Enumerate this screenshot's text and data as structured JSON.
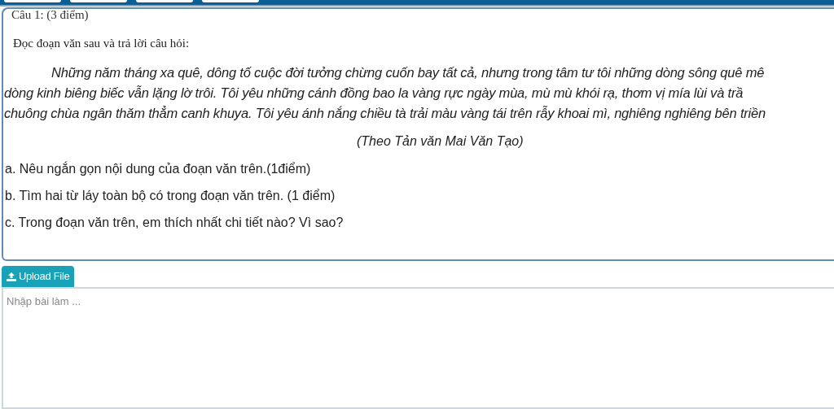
{
  "top_tabs": [
    {
      "kind": "tab"
    },
    {
      "kind": "tab"
    },
    {
      "kind": "tab"
    },
    {
      "kind": "tab"
    }
  ],
  "question": {
    "title": "Câu 1: (3 điểm)",
    "instruction": "Đọc đoạn văn sau và trả lời câu hỏi:",
    "passage_lines": [
      "Những năm tháng xa quê, dông tố cuộc đời tưởng chừng cuốn bay tất cả, nhưng trong tâm tư tôi những dòng sông quê mê",
      "dòng kinh biêng biếc vẫn lặng lờ trôi. Tôi yêu những cánh đồng bao la vàng rực ngày mùa, mù mù khói rạ, thơm vị mía lùi và trầ",
      "chuông chùa ngân thăm thẳm canh khuya. Tôi yêu ánh nắng chiều tà trải màu vàng tái trên rẫy khoai mì, nghiêng nghiêng bên triền"
    ],
    "source": "(Theo Tản văn Mai Văn Tạo)",
    "sub_questions": [
      "a. Nêu ngắn gọn nội dung của đoạn văn trên.(1điểm)",
      "b. Tìm hai từ láy toàn bộ có trong đoạn văn trên. (1 điểm)",
      "c. Trong đoạn văn trên, em thích nhất chi tiết nào? Vì sao?"
    ]
  },
  "upload_button": "Upload File",
  "answer": {
    "placeholder": "Nhập bài làm ..."
  }
}
